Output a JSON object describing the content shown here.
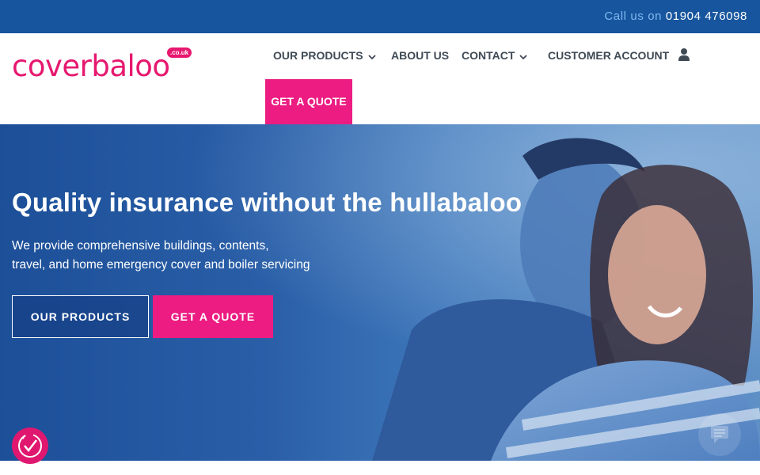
{
  "topbar": {
    "call_label": "Call us on",
    "phone": "01904 476098"
  },
  "logo": {
    "text": "coverbaloo",
    "badge": ".co.uk"
  },
  "nav": {
    "items": [
      {
        "label": "OUR PRODUCTS",
        "has_dropdown": true
      },
      {
        "label": "ABOUT US",
        "has_dropdown": false
      },
      {
        "label": "CONTACT",
        "has_dropdown": true
      },
      {
        "label": "CUSTOMER ACCOUNT",
        "icon": "user-icon"
      }
    ],
    "quote_label": "GET A QUOTE"
  },
  "hero": {
    "title": "Quality insurance without the hullabaloo",
    "subtitle_line1": "We provide comprehensive buildings, contents,",
    "subtitle_line2": "travel, and home emergency cover and boiler servicing",
    "primary_button": "OUR PRODUCTS",
    "secondary_button": "GET A QUOTE"
  },
  "widgets": {
    "accessibility_icon": "accessibility-icon",
    "chat_icon": "chat-icon"
  },
  "colors": {
    "topbar": "#17559e",
    "brand_pink": "#ec1c82",
    "nav_text": "#3f4a55",
    "hero_blue": "#1c4f98"
  }
}
